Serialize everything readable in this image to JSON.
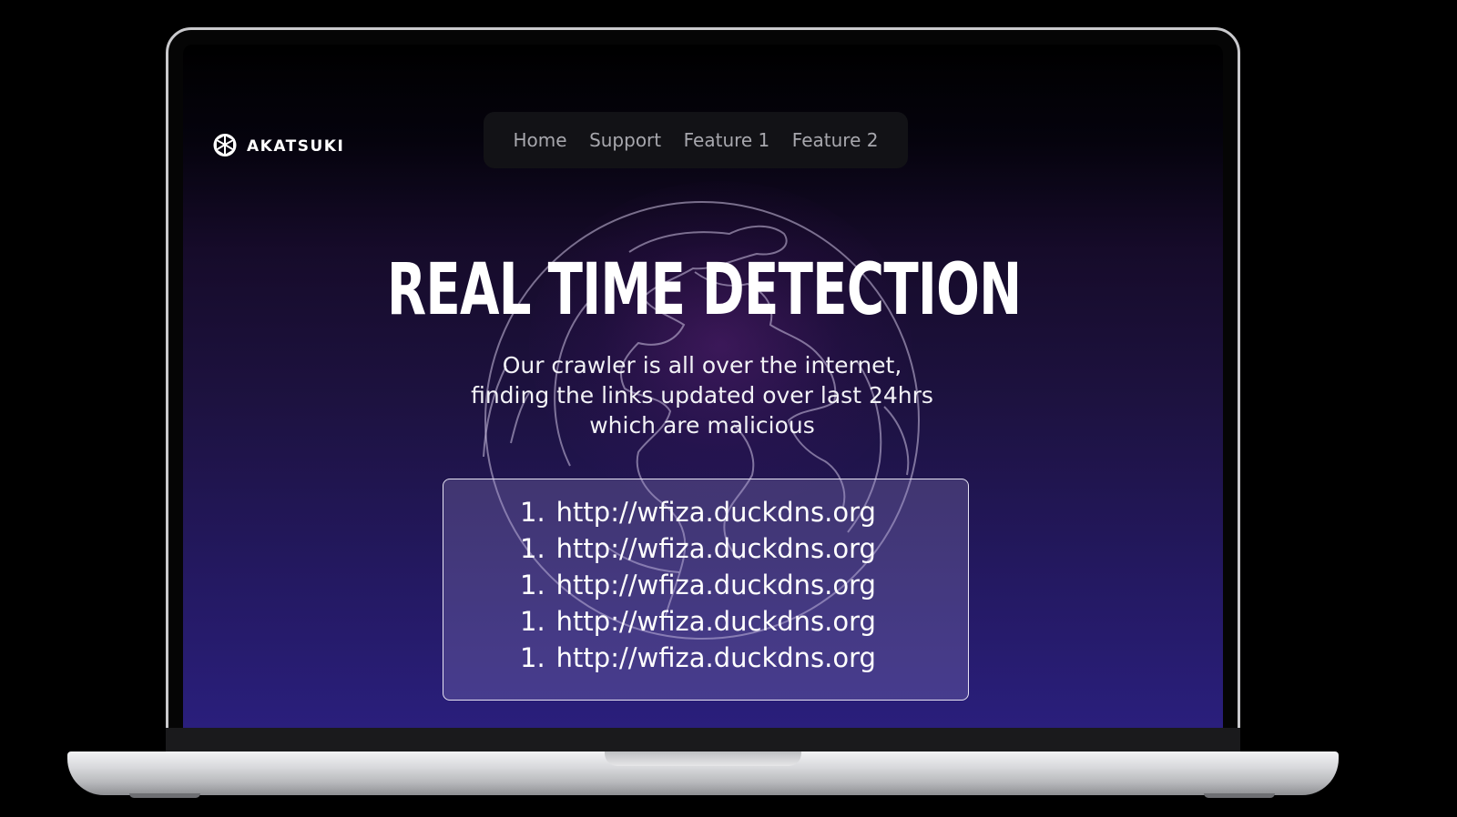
{
  "brand": {
    "name": "AKATSUKI",
    "logo_icon": "openai-knot-icon"
  },
  "nav": {
    "items": [
      {
        "label": "Home"
      },
      {
        "label": "Support"
      },
      {
        "label": "Feature 1"
      },
      {
        "label": "Feature 2"
      }
    ]
  },
  "hero": {
    "title": "REAL TIME DETECTION",
    "subtitle_lines": [
      "Our crawler is all over the internet,",
      "finding the links updated over last 24hrs",
      "which are malicious"
    ]
  },
  "links": [
    {
      "number": "1.",
      "url": "http://wfiza.duckdns.org"
    },
    {
      "number": "1.",
      "url": "http://wfiza.duckdns.org"
    },
    {
      "number": "1.",
      "url": "http://wfiza.duckdns.org"
    },
    {
      "number": "1.",
      "url": "http://wfiza.duckdns.org"
    },
    {
      "number": "1.",
      "url": "http://wfiza.duckdns.org"
    }
  ],
  "colors": {
    "page_background": "#000000",
    "screen_gradient_top": "#000000",
    "screen_gradient_bottom": "#2a1f7d",
    "nav_background": "#121216",
    "nav_text": "#a7a7ad",
    "links_box_border": "#e6e3f3",
    "text_primary": "#ffffff"
  },
  "decor": {
    "background_graphic": "globe-outline-icon",
    "device_frame": "laptop-mockup"
  }
}
